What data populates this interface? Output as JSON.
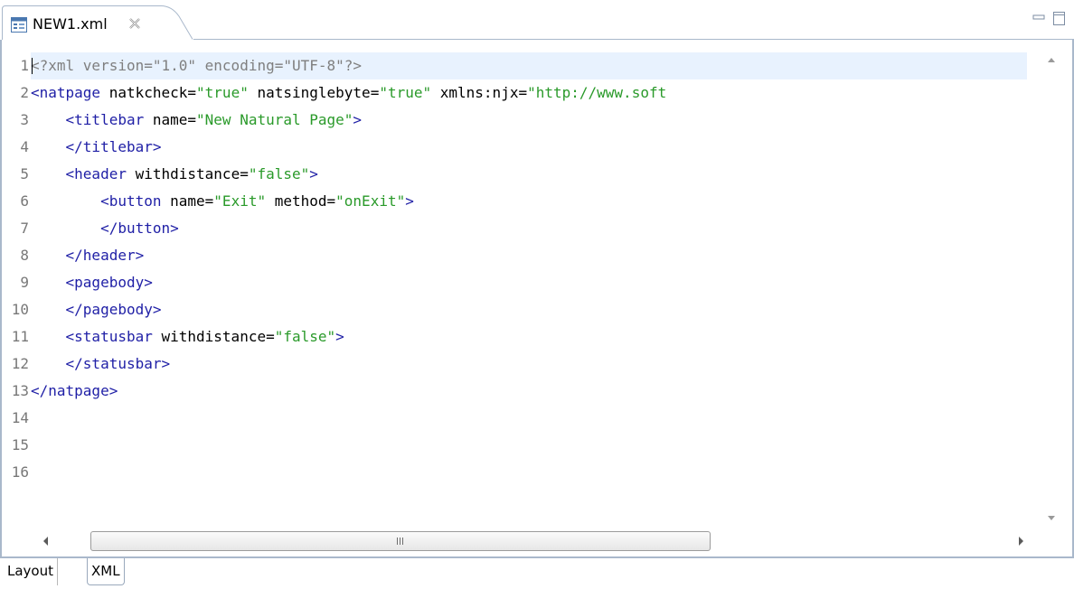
{
  "editor_tab": {
    "title": "NEW1.xml",
    "icon": "xml-file-icon",
    "close_icon": "close-icon"
  },
  "window_controls": {
    "minimize_icon": "minimize-icon",
    "maximize_icon": "maximize-icon"
  },
  "code": {
    "current_line": 1,
    "lines": [
      {
        "num": "1",
        "indent": "",
        "tokens": [
          {
            "t": "<?xml version=\"1.0\" encoding=\"UTF-8\"?>",
            "k": "decl"
          }
        ]
      },
      {
        "num": "2",
        "indent": "",
        "tokens": [
          {
            "t": "<natpage",
            "k": "tag"
          },
          {
            "t": " natkcheck=",
            "k": "attr"
          },
          {
            "t": "\"true\"",
            "k": "val"
          },
          {
            "t": " natsinglebyte=",
            "k": "attr"
          },
          {
            "t": "\"true\"",
            "k": "val"
          },
          {
            "t": " xmlns:njx=",
            "k": "attr"
          },
          {
            "t": "\"http://www.soft",
            "k": "val"
          }
        ]
      },
      {
        "num": "3",
        "indent": "    ",
        "tokens": [
          {
            "t": "<titlebar",
            "k": "tag"
          },
          {
            "t": " name=",
            "k": "attr"
          },
          {
            "t": "\"New Natural Page\"",
            "k": "val"
          },
          {
            "t": ">",
            "k": "tag"
          }
        ]
      },
      {
        "num": "4",
        "indent": "    ",
        "tokens": [
          {
            "t": "</titlebar>",
            "k": "tag"
          }
        ]
      },
      {
        "num": "5",
        "indent": "    ",
        "tokens": [
          {
            "t": "<header",
            "k": "tag"
          },
          {
            "t": " withdistance=",
            "k": "attr"
          },
          {
            "t": "\"false\"",
            "k": "val"
          },
          {
            "t": ">",
            "k": "tag"
          }
        ]
      },
      {
        "num": "6",
        "indent": "        ",
        "tokens": [
          {
            "t": "<button",
            "k": "tag"
          },
          {
            "t": " name=",
            "k": "attr"
          },
          {
            "t": "\"Exit\"",
            "k": "val"
          },
          {
            "t": " method=",
            "k": "attr"
          },
          {
            "t": "\"onExit\"",
            "k": "val"
          },
          {
            "t": ">",
            "k": "tag"
          }
        ]
      },
      {
        "num": "7",
        "indent": "        ",
        "tokens": [
          {
            "t": "</button>",
            "k": "tag"
          }
        ]
      },
      {
        "num": "8",
        "indent": "    ",
        "tokens": [
          {
            "t": "</header>",
            "k": "tag"
          }
        ]
      },
      {
        "num": "9",
        "indent": "    ",
        "tokens": [
          {
            "t": "<pagebody>",
            "k": "tag"
          }
        ]
      },
      {
        "num": "10",
        "indent": "    ",
        "tokens": [
          {
            "t": "</pagebody>",
            "k": "tag"
          }
        ]
      },
      {
        "num": "11",
        "indent": "    ",
        "tokens": [
          {
            "t": "<statusbar",
            "k": "tag"
          },
          {
            "t": " withdistance=",
            "k": "attr"
          },
          {
            "t": "\"false\"",
            "k": "val"
          },
          {
            "t": ">",
            "k": "tag"
          }
        ]
      },
      {
        "num": "12",
        "indent": "    ",
        "tokens": [
          {
            "t": "</statusbar>",
            "k": "tag"
          }
        ]
      },
      {
        "num": "13",
        "indent": "",
        "tokens": [
          {
            "t": "</natpage>",
            "k": "tag"
          }
        ]
      },
      {
        "num": "14",
        "indent": "",
        "tokens": []
      },
      {
        "num": "15",
        "indent": "",
        "tokens": []
      },
      {
        "num": "16",
        "indent": "",
        "tokens": []
      }
    ]
  },
  "scrollbars": {
    "up_icon": "scroll-up-arrow-icon",
    "down_icon": "scroll-down-arrow-icon",
    "left_icon": "scroll-left-arrow-icon",
    "right_icon": "scroll-right-arrow-icon",
    "grip_icon": "scroll-grip-icon"
  },
  "bottom_tabs": [
    {
      "label": "Layout",
      "active": false
    },
    {
      "label": "XML",
      "active": true
    }
  ],
  "colors": {
    "current_line_highlight": "#e8f2fe",
    "tag": "#1f1fa6",
    "attribute": "#000000",
    "value": "#2a9a2a",
    "declaration": "#7f7f7f",
    "line_number": "#787878",
    "border": "#a9b8cb"
  }
}
